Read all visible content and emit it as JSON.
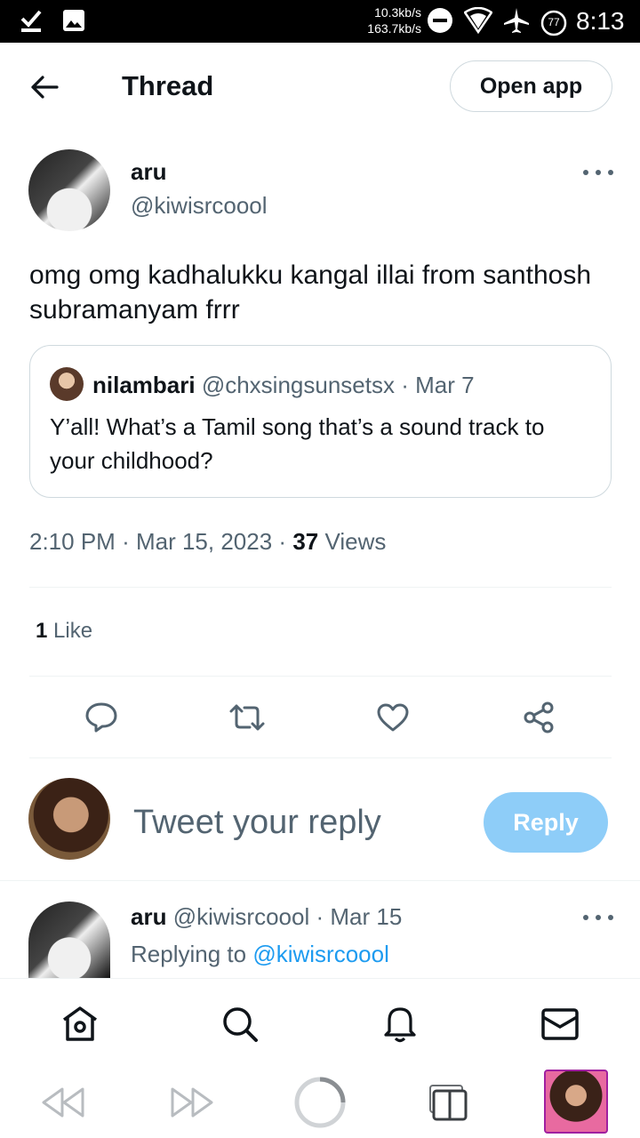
{
  "status_bar": {
    "speed_down": "10.3kb/s",
    "speed_up": "163.7kb/s",
    "battery": "77",
    "time": "8:13"
  },
  "header": {
    "title": "Thread",
    "open_app_label": "Open app"
  },
  "tweet": {
    "author_name": "aru",
    "author_handle": "@kiwisrcoool",
    "text": "omg omg kadhalukku kangal illai from santhosh subramanyam frrr",
    "quote": {
      "name": "nilambari",
      "handle": "@chxsingsunsetsx",
      "date": "Mar 7",
      "text": "Y’all! What’s a Tamil song that’s a sound track to your childhood?"
    },
    "time": "2:10 PM",
    "date": "Mar 15, 2023",
    "views_count": "37",
    "views_label": "Views",
    "likes_count": "1",
    "likes_label": "Like"
  },
  "reply_box": {
    "placeholder": "Tweet your reply",
    "button_label": "Reply"
  },
  "reply_tweet": {
    "author_name": "aru",
    "author_handle": "@kiwisrcoool",
    "date": "Mar 15",
    "replying_prefix": "Replying to",
    "replying_to": "@kiwisrcoool"
  },
  "colors": {
    "accent": "#1d9bf0",
    "reply_button": "#8ecdf8",
    "secondary_text": "#536471",
    "border": "#cfd9de"
  }
}
